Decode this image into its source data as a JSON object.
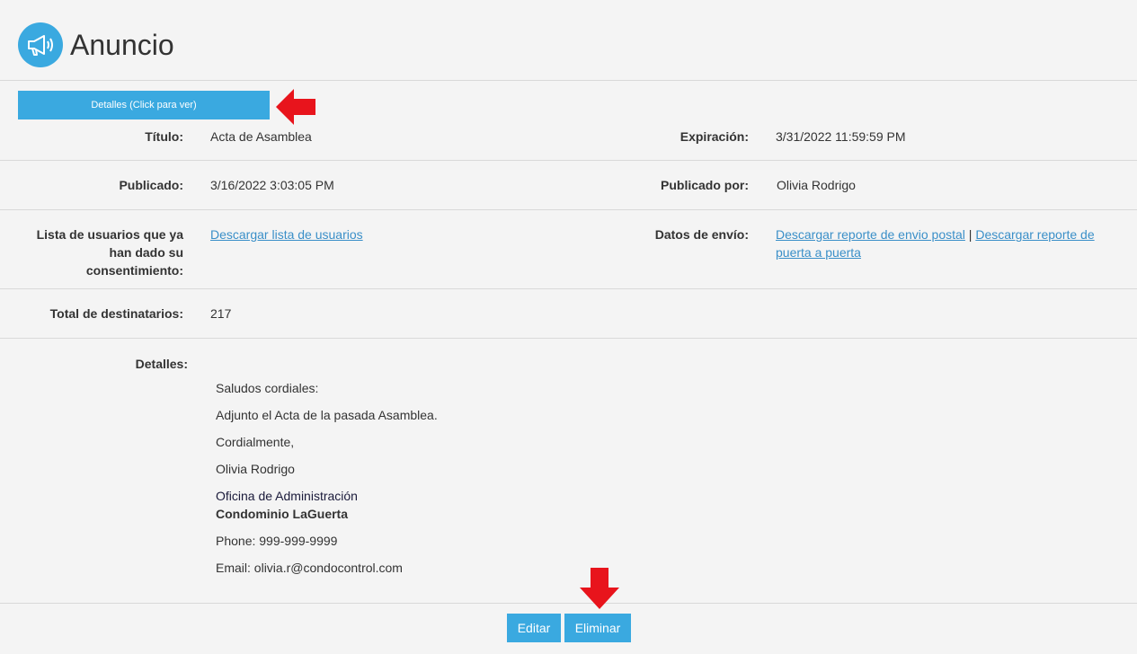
{
  "header": {
    "title": "Anuncio",
    "icon": "megaphone-icon"
  },
  "details_button": "Detalles (Click para ver)",
  "fields": {
    "titulo_label": "Título:",
    "titulo_value": "Acta de Asamblea",
    "expiracion_label": "Expiración:",
    "expiracion_value": "3/31/2022 11:59:59 PM",
    "publicado_label": "Publicado:",
    "publicado_value": "3/16/2022 3:03:05 PM",
    "publicado_por_label": "Publicado por:",
    "publicado_por_value": "Olivia Rodrigo",
    "lista_label_1": "Lista de usuarios que ya",
    "lista_label_2": "han dado su",
    "lista_label_3": "consentimiento:",
    "lista_link": "Descargar lista de usuarios",
    "datos_envio_label": "Datos de envío:",
    "envio_postal_link": "Descargar reporte de envio postal",
    "separator": "|",
    "puerta_link_1": "Descargar reporte de",
    "puerta_link_2": "puerta a puerta",
    "total_label": "Total de destinatarios:",
    "total_value": "217",
    "detalles_label": "Detalles:"
  },
  "message": {
    "greeting": "Saludos cordiales:",
    "body": "Adjunto el Acta de la pasada Asamblea.",
    "closing": "Cordialmente,",
    "signature": "Olivia Rodrigo",
    "office": "Oficina de Administración",
    "condo": "Condominio LaGuerta",
    "phone_label": "Phone:",
    "phone": "999-999-9999",
    "email_label": "Email:",
    "email": "olivia.r@condocontrol.com"
  },
  "actions": {
    "edit": "Editar",
    "delete": "Eliminar"
  },
  "colors": {
    "accent": "#3aa9e0",
    "arrow": "#e8141c",
    "link": "#3a8fc8"
  }
}
